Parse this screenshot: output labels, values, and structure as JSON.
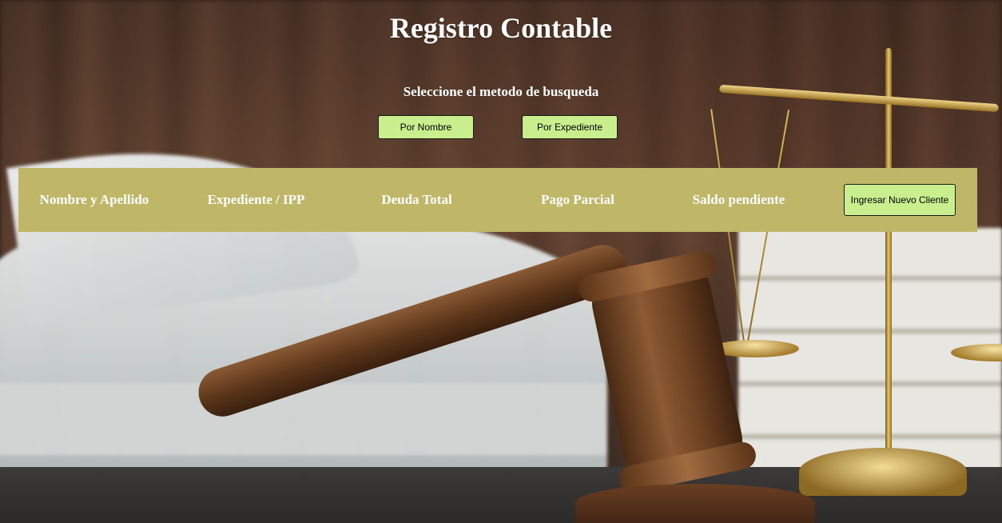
{
  "page": {
    "title": "Registro Contable",
    "subtitle": "Seleccione el metodo de busqueda"
  },
  "search": {
    "by_name_label": "Por Nombre",
    "by_file_label": "Por Expediente"
  },
  "table_header": {
    "columns": [
      "Nombre y Apellido",
      "Expediente / IPP",
      "Deuda Total",
      "Pago Parcial",
      "Saldo pendiente"
    ],
    "add_client_label": "Ingresar Nuevo Cliente"
  },
  "colors": {
    "button_bg": "#c9ee8e",
    "header_bar_bg": "#bfb767",
    "text": "#ffffff"
  }
}
